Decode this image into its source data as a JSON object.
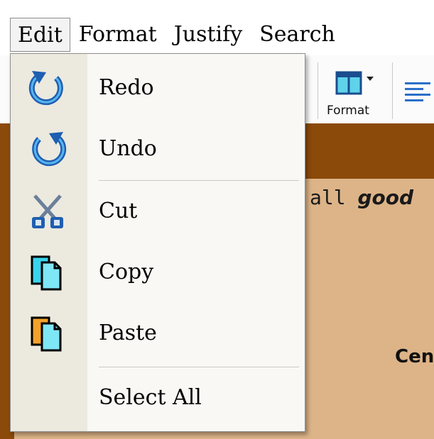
{
  "menubar": {
    "items": [
      "Edit",
      "Format",
      "Justify",
      "Search"
    ]
  },
  "toolbar": {
    "format_label": "Format"
  },
  "document": {
    "line1_prefix": "all ",
    "line1_emph": "good",
    "center_fragment": "Cen"
  },
  "edit_menu": {
    "items": [
      {
        "label": "Redo",
        "icon": "redo-icon"
      },
      {
        "label": "Undo",
        "icon": "undo-icon"
      },
      {
        "label": "Cut",
        "icon": "cut-icon"
      },
      {
        "label": "Copy",
        "icon": "copy-icon"
      },
      {
        "label": "Paste",
        "icon": "paste-icon"
      },
      {
        "label": "Select All",
        "icon": ""
      }
    ]
  },
  "colors": {
    "document_band": "#8b4a0a",
    "document_body": "#ddb488",
    "icon_blue": "#1e6fc8",
    "icon_cyan": "#39d3ec",
    "icon_orange": "#f3a12a"
  }
}
